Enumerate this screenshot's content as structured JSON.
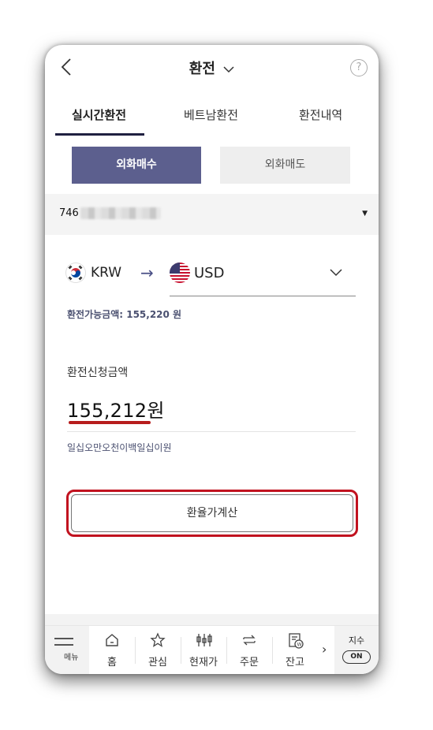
{
  "header": {
    "title": "환전"
  },
  "tabs": [
    {
      "label": "실시간환전",
      "active": true
    },
    {
      "label": "베트남환전",
      "active": false
    },
    {
      "label": "환전내역",
      "active": false
    }
  ],
  "segments": {
    "buy_label": "외화매수",
    "sell_label": "외화매도",
    "selected": "buy"
  },
  "account": {
    "number_visible": "746"
  },
  "currency": {
    "from": "KRW",
    "to": "USD"
  },
  "available": {
    "text": "환전가능금액: 155,220 원"
  },
  "request": {
    "label": "환전신청금액",
    "amount": "155,212원",
    "amount_in_words": "일십오만오천이백일십이원"
  },
  "calc_button": {
    "label": "환율가계산"
  },
  "bottom_nav": {
    "menu_label": "메뉴",
    "items": [
      {
        "label": "홈",
        "icon": "home-icon"
      },
      {
        "label": "관심",
        "icon": "star-icon"
      },
      {
        "label": "현재가",
        "icon": "candlestick-icon"
      },
      {
        "label": "주문",
        "icon": "swap-arrows-icon"
      },
      {
        "label": "잔고",
        "icon": "balance-doc-icon"
      }
    ],
    "index_label": "지수",
    "index_toggle": "ON"
  },
  "colors": {
    "accent": "#5c5f8e",
    "highlight": "#c1121f",
    "text_muted": "#4a5070"
  }
}
